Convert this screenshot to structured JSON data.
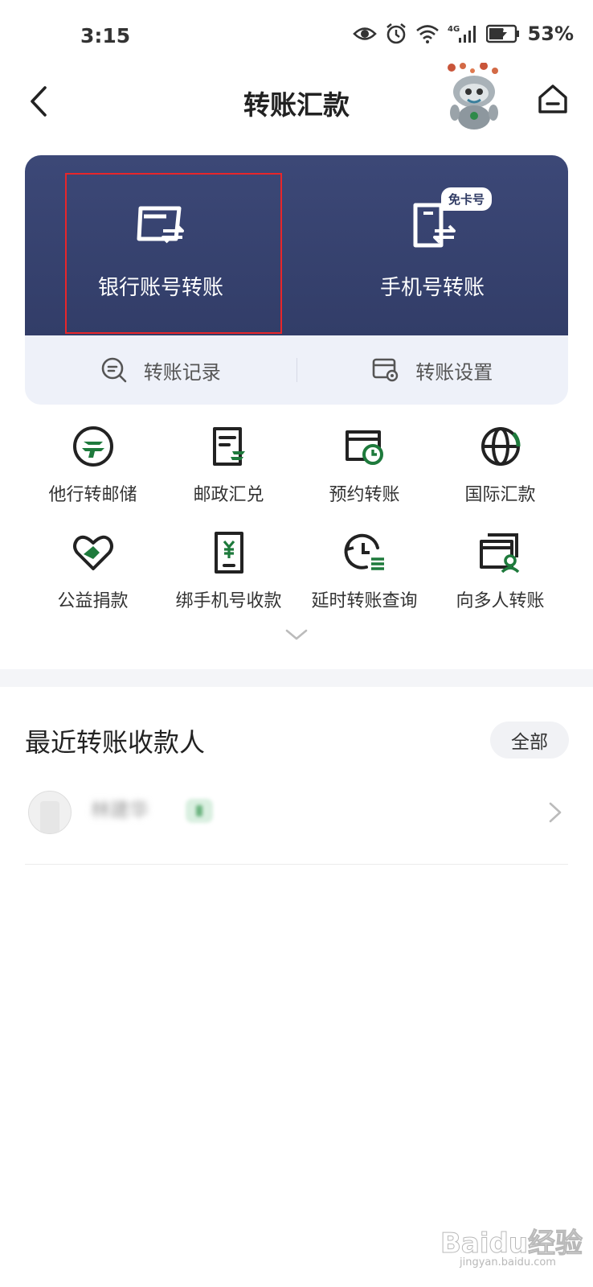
{
  "status_bar": {
    "time": "3:15",
    "network": "4G",
    "battery": "53%"
  },
  "header": {
    "title": "转账汇款"
  },
  "main_card": {
    "bank_transfer_label": "银行账号转账",
    "phone_transfer_label": "手机号转账",
    "phone_transfer_badge": "免卡号",
    "records_label": "转账记录",
    "settings_label": "转账设置",
    "top_color": "#3c4877",
    "highlight_color": "#e8262a"
  },
  "grid": {
    "row1": [
      {
        "label": "他行转邮储",
        "icon": "postal-logo-icon"
      },
      {
        "label": "邮政汇兑",
        "icon": "remittance-doc-icon"
      },
      {
        "label": "预约转账",
        "icon": "scheduled-transfer-icon"
      },
      {
        "label": "国际汇款",
        "icon": "globe-icon"
      }
    ],
    "row2": [
      {
        "label": "公益捐款",
        "icon": "heart-handshake-icon"
      },
      {
        "label": "绑手机号收款",
        "icon": "phone-yuan-icon"
      },
      {
        "label": "延时转账查询",
        "icon": "delayed-query-icon"
      },
      {
        "label": "向多人转账",
        "icon": "multi-person-icon"
      }
    ],
    "accent_color": "#1e7a3c"
  },
  "recent": {
    "title": "最近转账收款人",
    "all_label": "全部",
    "items": [
      {
        "name": "林建华"
      }
    ]
  },
  "watermark": {
    "text": "Baidu经验",
    "sub": "jingyan.baidu.com"
  }
}
